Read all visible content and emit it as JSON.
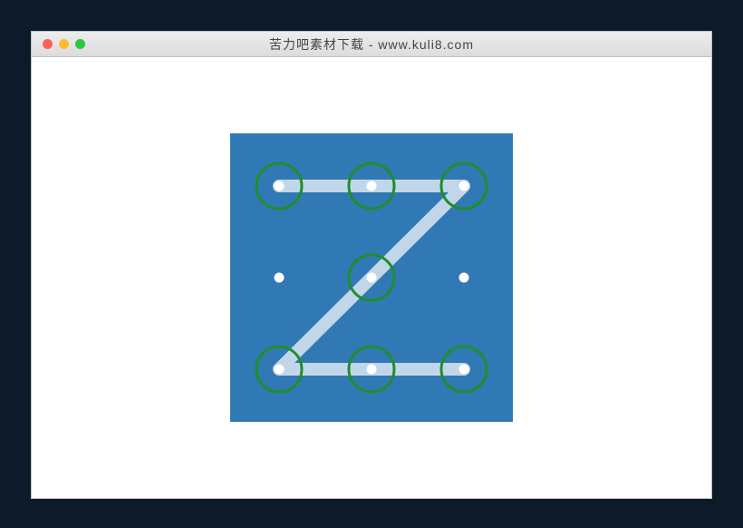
{
  "window": {
    "title": "苦力吧素材下载 - www.kuli8.com"
  },
  "pattern_lock": {
    "grid_size": 3,
    "background": "#3079b5",
    "dot_color": "#ffffff",
    "ring_color": "#1f8e2a",
    "line_color": "rgba(255,255,255,0.7)",
    "nodes": [
      {
        "id": 0,
        "row": 0,
        "col": 0,
        "selected": true
      },
      {
        "id": 1,
        "row": 0,
        "col": 1,
        "selected": true
      },
      {
        "id": 2,
        "row": 0,
        "col": 2,
        "selected": true
      },
      {
        "id": 3,
        "row": 1,
        "col": 0,
        "selected": false
      },
      {
        "id": 4,
        "row": 1,
        "col": 1,
        "selected": true
      },
      {
        "id": 5,
        "row": 1,
        "col": 2,
        "selected": false
      },
      {
        "id": 6,
        "row": 2,
        "col": 0,
        "selected": true
      },
      {
        "id": 7,
        "row": 2,
        "col": 1,
        "selected": true
      },
      {
        "id": 8,
        "row": 2,
        "col": 2,
        "selected": true
      }
    ],
    "path": [
      0,
      1,
      2,
      4,
      6,
      7,
      8
    ]
  }
}
